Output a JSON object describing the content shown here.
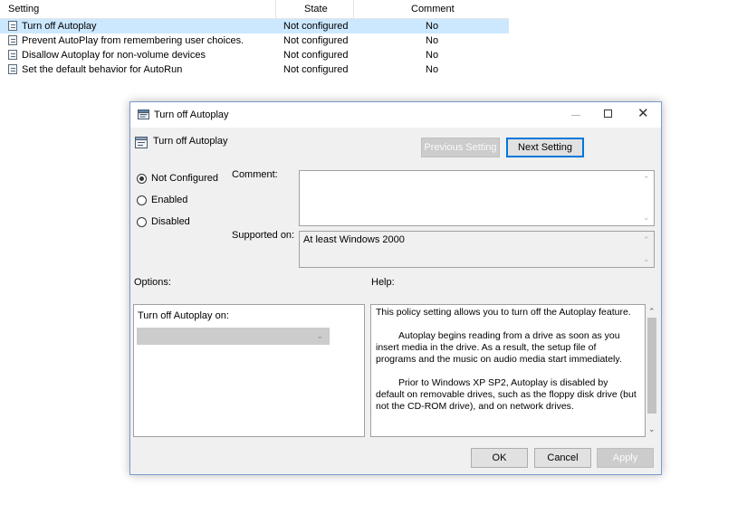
{
  "list": {
    "headers": {
      "setting": "Setting",
      "state": "State",
      "comment": "Comment"
    },
    "rows": [
      {
        "setting": "Turn off Autoplay",
        "state": "Not configured",
        "comment": "No",
        "selected": true
      },
      {
        "setting": "Prevent AutoPlay from remembering user choices.",
        "state": "Not configured",
        "comment": "No"
      },
      {
        "setting": "Disallow Autoplay for non-volume devices",
        "state": "Not configured",
        "comment": "No"
      },
      {
        "setting": "Set the default behavior for AutoRun",
        "state": "Not configured",
        "comment": "No"
      }
    ]
  },
  "dialog": {
    "title": "Turn off Autoplay",
    "policy_name": "Turn off Autoplay",
    "prev_label": "Previous Setting",
    "next_label": "Next Setting",
    "radios": [
      {
        "label": "Not Configured",
        "checked": true
      },
      {
        "label": "Enabled",
        "checked": false
      },
      {
        "label": "Disabled",
        "checked": false
      }
    ],
    "comment_label": "Comment:",
    "comment_value": "",
    "supported_label": "Supported on:",
    "supported_value": "At least Windows 2000",
    "options_label": "Options:",
    "help_label": "Help:",
    "option_field_label": "Turn off Autoplay on:",
    "option_field_value": "",
    "help_paragraphs": [
      "This policy setting allows you to turn off the Autoplay feature.",
      "Autoplay begins reading from a drive as soon as you insert media in the drive. As a result, the setup file of programs and the music on audio media start immediately.",
      "Prior to Windows XP SP2, Autoplay is disabled by default on removable drives, such as the floppy disk drive (but not the CD-ROM drive), and on network drives."
    ],
    "ok_label": "OK",
    "cancel_label": "Cancel",
    "apply_label": "Apply"
  },
  "colors": {
    "selection": "#cce8ff",
    "accent": "#0078d7",
    "dialog_bg": "#f0f0f0"
  },
  "icons": {
    "policy": "policy-setting-icon",
    "dialog": "group-policy-editor-icon",
    "close": "close-icon",
    "maximize": "maximize-icon",
    "minimize": "minimize-icon"
  }
}
